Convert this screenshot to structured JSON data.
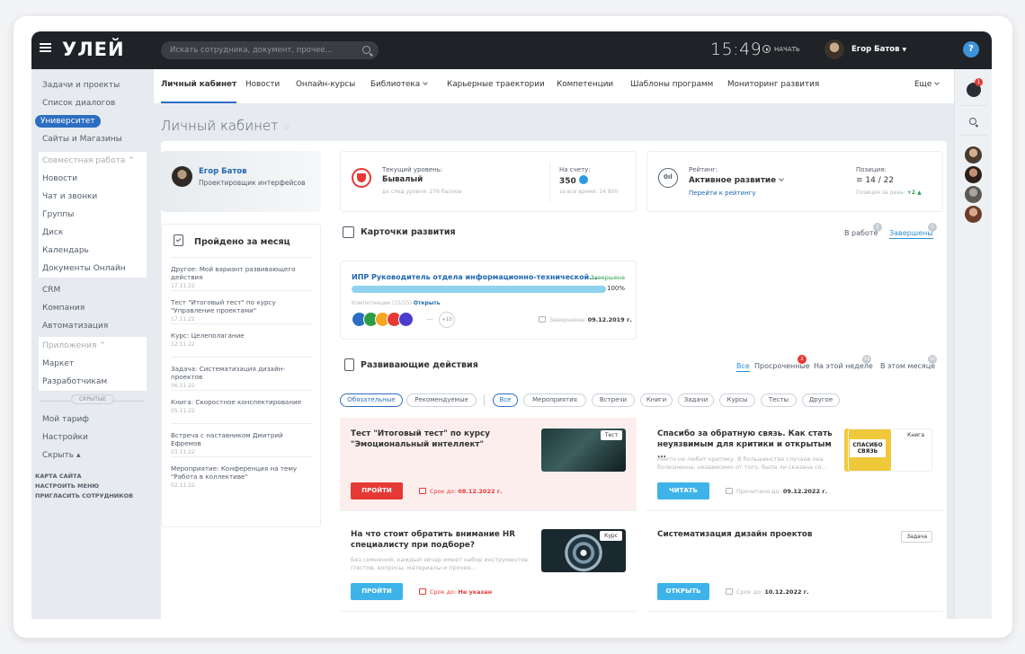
{
  "header": {
    "logo": "УЛЕЙ",
    "search_placeholder": "Искать сотрудника, документ, прочее...",
    "time": "15:49",
    "start_label": "НАЧАТЬ",
    "user_name": "Егор Батов",
    "help": "?"
  },
  "left_menu": {
    "group1": [
      "Задачи и проекты",
      "Список диалогов",
      "Университет",
      "Сайты и Магазины"
    ],
    "group2_title": "Совместная работа ⌃",
    "group2": [
      "Новости",
      "Чат и звонки",
      "Группы",
      "Диск",
      "Календарь",
      "Документы Онлайн"
    ],
    "group3": [
      "CRM",
      "Компания",
      "Автоматизация"
    ],
    "group4_title": "Приложения ⌃",
    "group4": [
      "Маркет",
      "Разработчикам"
    ],
    "hidden_label": "СКРЫТЫЕ",
    "bottom": [
      "Мой тариф",
      "Настройки",
      "Скрыть ▴"
    ],
    "small_links": [
      "КАРТА САЙТА",
      "НАСТРОИТЬ МЕНЮ",
      "ПРИГЛАСИТЬ СОТРУДНИКОВ"
    ]
  },
  "tabs": [
    "Личный кабинет",
    "Новости",
    "Онлайн-курсы",
    "Библиотека",
    "Карьерные траектории",
    "Компетенции",
    "Шаблоны программ",
    "Мониторинг развития",
    "Еще"
  ],
  "page": {
    "title": "Личный кабинет"
  },
  "profile": {
    "name": "Егор Батов",
    "role": "Проектировщик интерфейсов"
  },
  "month": {
    "title": "Пройдено за месяц",
    "items": [
      {
        "text": "Другое: Мой вариант развивающего действия",
        "date": "17.11.22"
      },
      {
        "text": "Тест \"Итоговый тест\" по курсу \"Управление проектами\"",
        "date": "17.11.22"
      },
      {
        "text": "Курс: Целеполагание",
        "date": "12.11.22"
      },
      {
        "text": "Задача: Систематизация дизайн-проектов",
        "date": "06.11.22"
      },
      {
        "text": "Книга: Скоростное конспектирование",
        "date": "05.11.22"
      },
      {
        "text": "Встреча с наставником Дмитрий Ефремов",
        "date": "03.11.22"
      },
      {
        "text": "Мероприятие: Конференция на тему \"Работа в коллективе\"",
        "date": "02.11.22"
      }
    ]
  },
  "level": {
    "label": "Текущий уровень:",
    "value": "Бывалый",
    "next": "до след.уровня: 276 баллов",
    "account_label": "На счету:",
    "account_value": "350",
    "account_all": "за все время: 14 890"
  },
  "rating": {
    "label": "Рейтинг:",
    "value": "Активное развитие",
    "link": "Перейти к рейтингу",
    "position_label": "Позиция:",
    "position_value": "14 / 22",
    "position_day_label": "Позиция за день:",
    "position_day_value": "+2 ▲"
  },
  "dev_cards": {
    "title": "Карточки развития",
    "filters": [
      {
        "label": "В работе",
        "count": "2"
      },
      {
        "label": "Завершены",
        "count": "1"
      }
    ],
    "ipr": {
      "title": "ИПР Руководитель отдела информационно-технической...",
      "status": "Завершена",
      "progress": 100,
      "progress_label": "100%",
      "competencies": "Компетенции (15/15)",
      "open": "Открыть",
      "more": "+10",
      "done_label": "Завершена:",
      "done_date": "09.12.2019 г."
    }
  },
  "actions": {
    "title": "Развивающие действия",
    "filters": [
      {
        "label": "Все",
        "count": ""
      },
      {
        "label": "Просроченные",
        "count": "2"
      },
      {
        "label": "На этой неделе",
        "count": "10"
      },
      {
        "label": "В этом месяце",
        "count": "10"
      }
    ],
    "pills": [
      "Обязательные",
      "Рекомендуемые",
      "Все",
      "Мероприятия",
      "Встречи",
      "Книги",
      "Задачи",
      "Курсы",
      "Тесты",
      "Другое"
    ],
    "cards": [
      {
        "title": "Тест \"Итоговый тест\" по курсу \"Эмоциональный интеллект\"",
        "desc": "",
        "button": "ПРОЙТИ",
        "due_label": "Срок до:",
        "due": "08.12.2022 г.",
        "badge": "Тест"
      },
      {
        "title": "Спасибо за обратную связь. Как стать неуязвимым для критики и открытым ...",
        "desc": "Никто не любит критику. В большинстве случаев она болезненна, независимо от того, была ли сказана со...",
        "button": "ЧИТАТЬ",
        "due_label": "Прочитано до:",
        "due": "09.12.2022 г.",
        "badge": "Книга"
      },
      {
        "title": "На что стоит обратить внимание HR специалисту при подборе?",
        "desc": "Без сомнений, каждый эйчар имеет набор инструментов (тестов, вопросы, материалы и прочее...",
        "button": "ПРОЙТИ",
        "due_label": "Срок до:",
        "due": "Не указан",
        "badge": "Курс"
      },
      {
        "title": "Систематизация дизайн проектов",
        "desc": "",
        "button": "ОТКРЫТЬ",
        "due_label": "Срок до:",
        "due": "10.12.2022 г.",
        "badge": "Задача"
      }
    ]
  },
  "book_cover_text": "СПАСИБО СВЯЗЬ"
}
